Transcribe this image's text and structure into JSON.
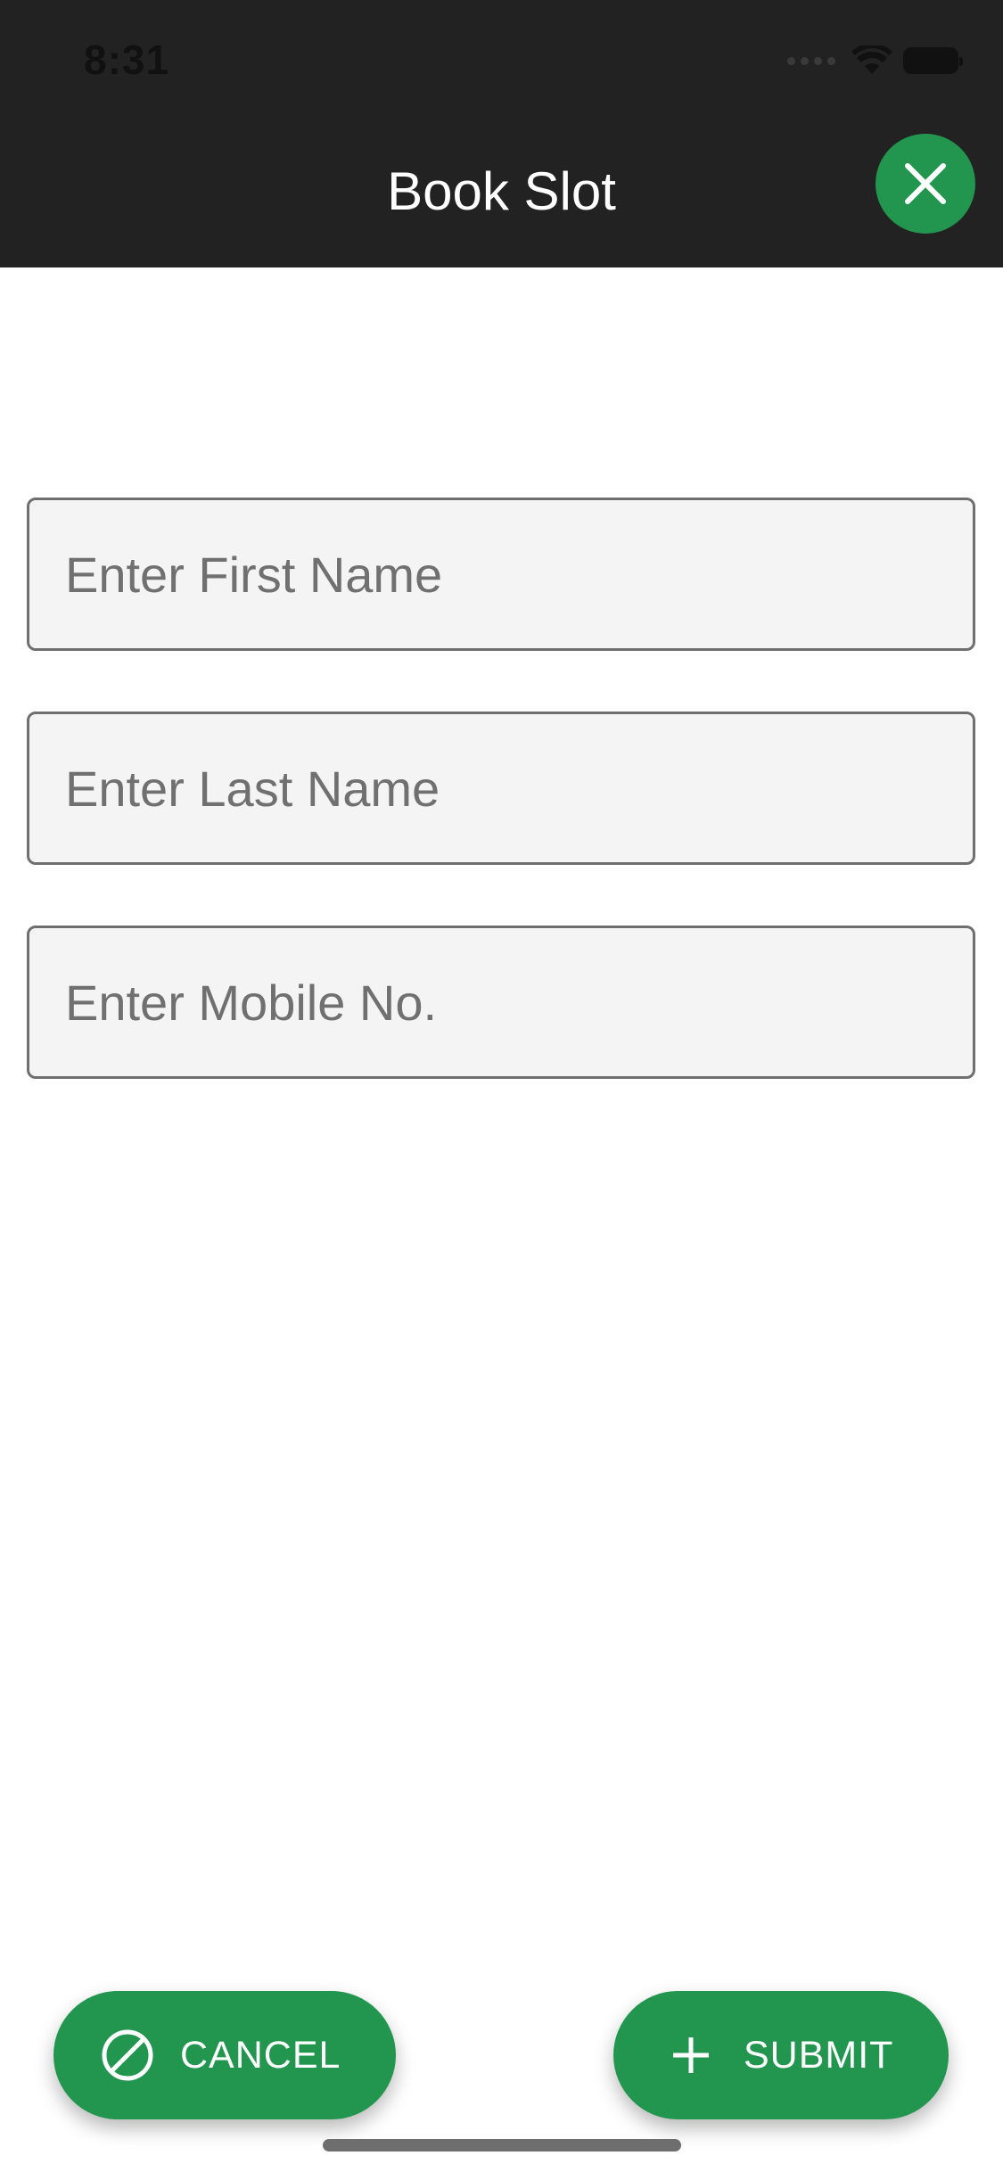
{
  "status_bar": {
    "time": "8:31"
  },
  "header": {
    "title": "Book Slot",
    "close_icon": "close-icon"
  },
  "form": {
    "first_name": {
      "value": "",
      "placeholder": "Enter First Name"
    },
    "last_name": {
      "value": "",
      "placeholder": "Enter Last Name"
    },
    "mobile": {
      "value": "",
      "placeholder": "Enter Mobile No."
    }
  },
  "actions": {
    "cancel": {
      "label": "CANCEL",
      "icon": "block-icon"
    },
    "submit": {
      "label": "SUBMIT",
      "icon": "plus-icon"
    }
  },
  "colors": {
    "header_bg": "#222222",
    "accent": "#22964f",
    "field_bg": "#f4f4f4",
    "field_border": "#6f6f6f"
  }
}
